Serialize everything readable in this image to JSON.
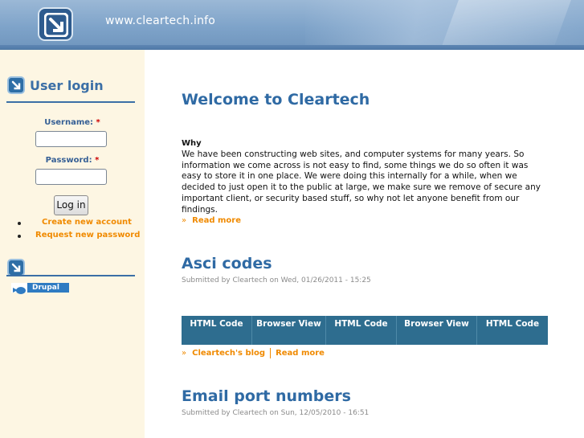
{
  "header": {
    "site_url": "www.cleartech.info"
  },
  "sidebar": {
    "login_block": {
      "title": "User login",
      "username_label": "Username:",
      "password_label": "Password:",
      "required_marker": "*",
      "username_value": "",
      "password_value": "",
      "login_button": "Log in",
      "links": [
        "Create new account",
        "Request new password"
      ]
    },
    "powered_by": {
      "badge_text": "Drupal"
    }
  },
  "main": {
    "nodes": [
      {
        "title": "Welcome to Cleartech",
        "subheading": "Why",
        "body": "We have been constructing web sites, and computer systems for many years. So information we come across is not easy to find, some things we do so often it was easy to store it in one place. We were doing this internally for a while, when we decided to just open it to the public at large, we make sure we remove of secure any important client, or security based stuff, so why not let anyone benefit from our findings.",
        "read_more": "Read more"
      },
      {
        "title": "Asci codes",
        "submitted": "Submitted by Cleartech on Wed, 01/26/2011 - 15:25",
        "table_headers": [
          "HTML Code",
          "Browser View",
          "HTML Code",
          "Browser View",
          "HTML Code"
        ],
        "blog_link": "Cleartech's blog",
        "read_more": "Read more"
      },
      {
        "title": "Email port numbers",
        "submitted": "Submitted by Cleartech on Sun, 12/05/2010 - 16:51"
      }
    ],
    "link_prefix": "»"
  },
  "colors": {
    "accent_blue": "#2f6aa4",
    "link_orange": "#f08a00",
    "sidebar_bg": "#fdf6e3",
    "table_bg": "#2e6d8f"
  },
  "icons": {
    "site_logo": "arrow-down-right-icon",
    "block_logo": "arrow-down-right-icon",
    "drupal_logo": "drupal-drop-icon"
  }
}
